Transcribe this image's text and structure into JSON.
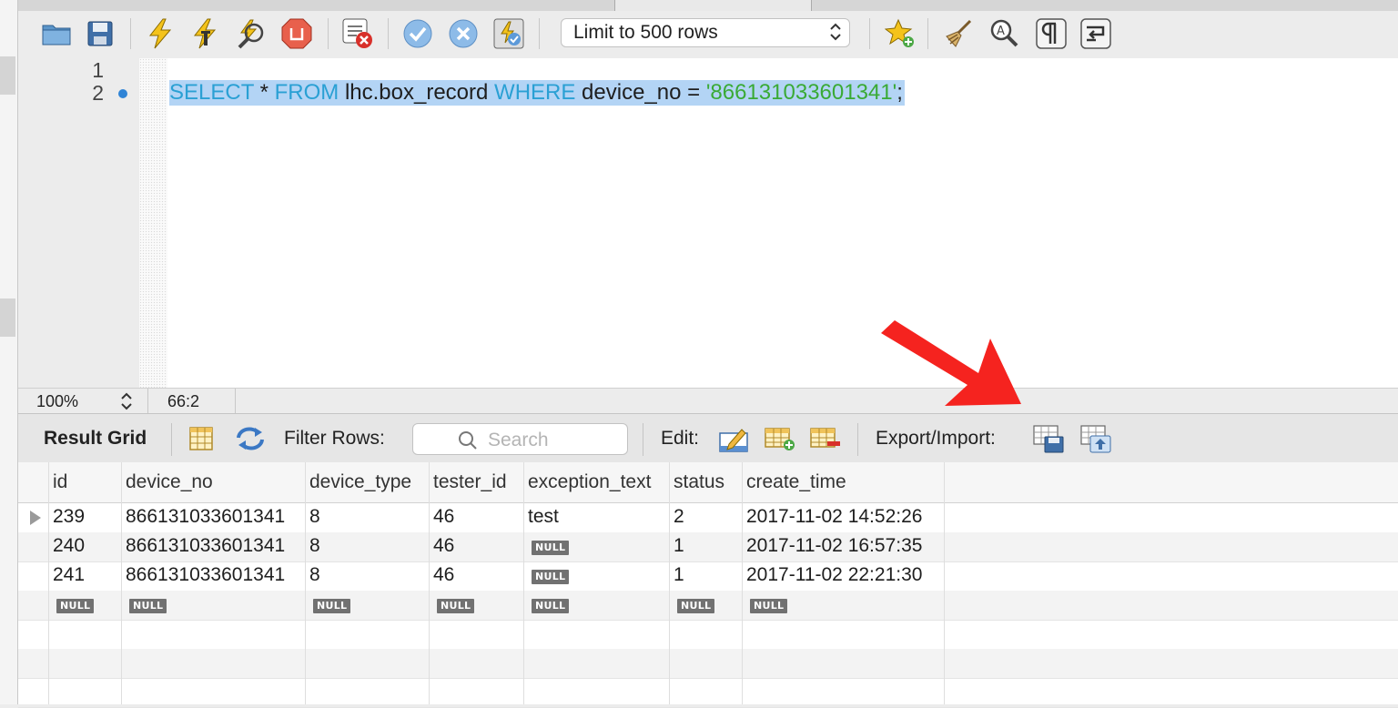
{
  "toolbar": {
    "limit_select": "Limit to 500 rows",
    "icons": [
      "open-folder-icon",
      "save-icon",
      "execute-icon",
      "execute-current-icon",
      "explain-icon",
      "stop-icon",
      "toggle-continue-on-error-icon",
      "commit-icon",
      "rollback-icon",
      "autocommit-icon",
      "add-snippet-icon",
      "beautify-icon",
      "find-icon",
      "invisible-chars-icon",
      "wrap-lines-icon"
    ]
  },
  "editor": {
    "line_numbers": [
      "1",
      "2"
    ],
    "sql": {
      "kw_select": "SELECT",
      "star": " * ",
      "kw_from": "FROM",
      "table": " lhc.box_record ",
      "kw_where": "WHERE",
      "cond": " device_no = ",
      "value": "'866131033601341'",
      "end": ";"
    }
  },
  "statusbar": {
    "zoom": "100%",
    "cursor": "66:2"
  },
  "result_toolbar": {
    "result_grid_label": "Result Grid",
    "filter_rows_label": "Filter Rows:",
    "search_placeholder": "Search",
    "edit_label": "Edit:",
    "export_import_label": "Export/Import:"
  },
  "grid": {
    "columns": [
      "id",
      "device_no",
      "device_type",
      "tester_id",
      "exception_text",
      "status",
      "create_time"
    ],
    "null_label": "NULL",
    "rows": [
      [
        "239",
        "866131033601341",
        "8",
        "46",
        "test",
        "2",
        "2017-11-02 14:52:26"
      ],
      [
        "240",
        "866131033601341",
        "8",
        "46",
        null,
        "1",
        "2017-11-02 16:57:35"
      ],
      [
        "241",
        "866131033601341",
        "8",
        "46",
        null,
        "1",
        "2017-11-02 22:21:30"
      ],
      [
        null,
        null,
        null,
        null,
        null,
        null,
        null
      ]
    ]
  },
  "annotation": {
    "arrow_color": "#f5231f"
  }
}
